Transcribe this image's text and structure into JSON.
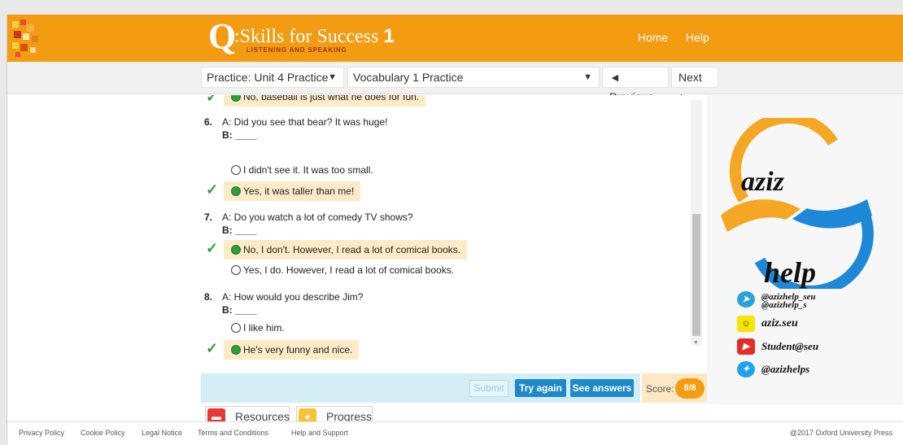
{
  "header": {
    "brand_q": "Q",
    "brand_title": ":Skills for Success",
    "brand_level": "1",
    "brand_subtitle": "LISTENING AND SPEAKING",
    "nav": {
      "home": "Home",
      "help": "Help"
    },
    "color": "#f39c12"
  },
  "breadcrumb": {
    "unit_select": "Practice: Unit 4 Practice",
    "activity_select": "Vocabulary 1 Practice",
    "previous": "◄ Previous",
    "next": "Next ►"
  },
  "exercise": {
    "partial_answer": "No, baseball is just what he does for fun.",
    "questions": [
      {
        "num": "6.",
        "a": "A: Did you see that bear? It was huge!",
        "b": "B: ____",
        "options": [
          {
            "text": "I didn't see it. It was too small.",
            "selected": false
          },
          {
            "text": "Yes, it was taller than me!",
            "selected": true
          }
        ]
      },
      {
        "num": "7.",
        "a": "A: Do you watch a lot of comedy TV shows?",
        "b": "B: ____",
        "options": [
          {
            "text": "No, I don't. However, I read a lot of comical books.",
            "selected": true
          },
          {
            "text": "Yes, I do. However, I read a lot of comical books.",
            "selected": false
          }
        ]
      },
      {
        "num": "8.",
        "a": "A: How would you describe Jim?",
        "b": "B: ____",
        "options": [
          {
            "text": "I like him.",
            "selected": false
          },
          {
            "text": "He's very funny and nice.",
            "selected": true
          }
        ]
      }
    ]
  },
  "actions": {
    "submit": "Submit",
    "try_again": "Try again",
    "see_answers": "See answers",
    "score_label": "Score:",
    "score_value": "8/8"
  },
  "tools": {
    "resources": "Resources",
    "progress": "Progress"
  },
  "footer": {
    "links": [
      "Privacy Policy",
      "Cookie Policy",
      "Legal Notice",
      "Terms and Conditions",
      "Help and Support"
    ],
    "copyright": "@2017 Oxford University Press"
  },
  "watermark": {
    "word1": "aziz",
    "word2": "help",
    "telegram": "@azizhelp_seu",
    "telegram2": "@azizhelp_s",
    "snapchat": "aziz.seu",
    "youtube": "Student@seu",
    "twitter": "@azizhelps"
  }
}
